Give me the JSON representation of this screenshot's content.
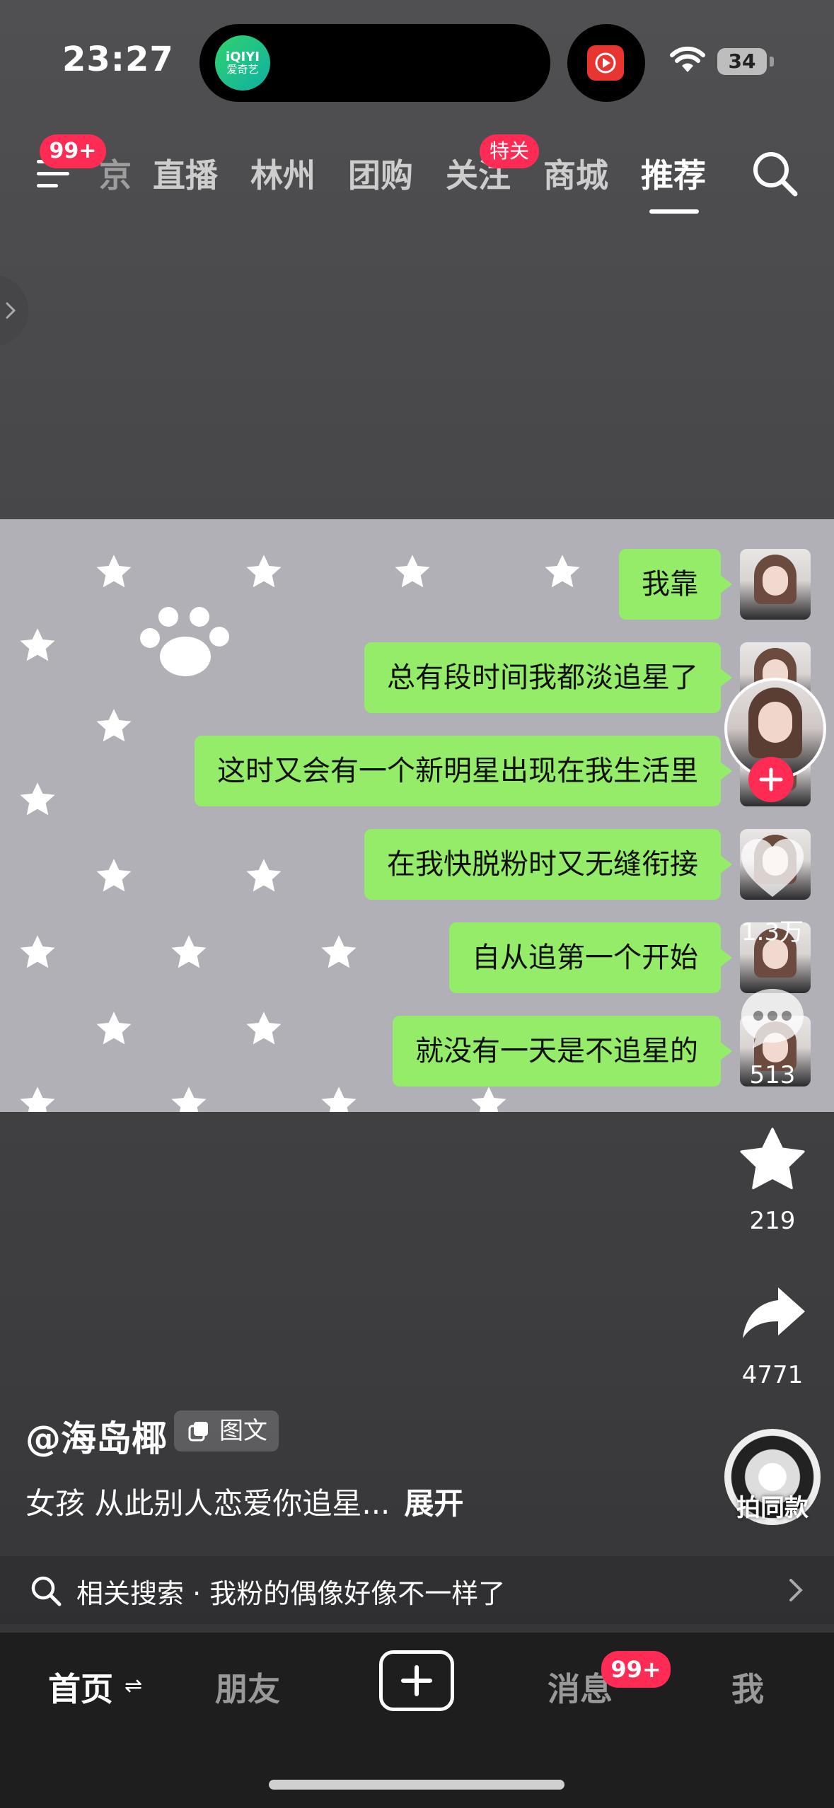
{
  "status_bar": {
    "time": "23:27",
    "island_app_line1": "iQIYI",
    "island_app_line2": "爱奇艺",
    "battery": "34"
  },
  "top_nav": {
    "menu_badge": "99+",
    "partial_tab": "京",
    "tabs": [
      "直播",
      "林州",
      "团购",
      "关注",
      "商城",
      "推荐"
    ],
    "active_tab": "推荐",
    "follow_badge": "特关"
  },
  "chat": {
    "messages": [
      "我靠",
      "总有段时间我都淡追星了",
      "这时又会有一个新明星出现在我生活里",
      "在我快脱粉时又无缝衔接",
      "自从追第一个开始",
      "就没有一天是不追星的"
    ]
  },
  "actions": {
    "likes": "1.3万",
    "comments": "513",
    "favorites": "219",
    "shares": "4771",
    "music_label": "拍同款"
  },
  "post": {
    "author": "@海岛椰",
    "type_badge": "图文",
    "caption": "女孩 从此别人恋爱你追星...",
    "expand": "展开"
  },
  "related_search": {
    "label": "相关搜索 · 我粉的偶像好像不一样了"
  },
  "bottom_tabs": {
    "home": "首页",
    "friends": "朋友",
    "messages": "消息",
    "messages_badge": "99+",
    "me": "我"
  },
  "colors": {
    "accent_red": "#fe2c55",
    "chat_bubble": "#95ec69",
    "tabbar_bg": "#1e1e1f"
  }
}
